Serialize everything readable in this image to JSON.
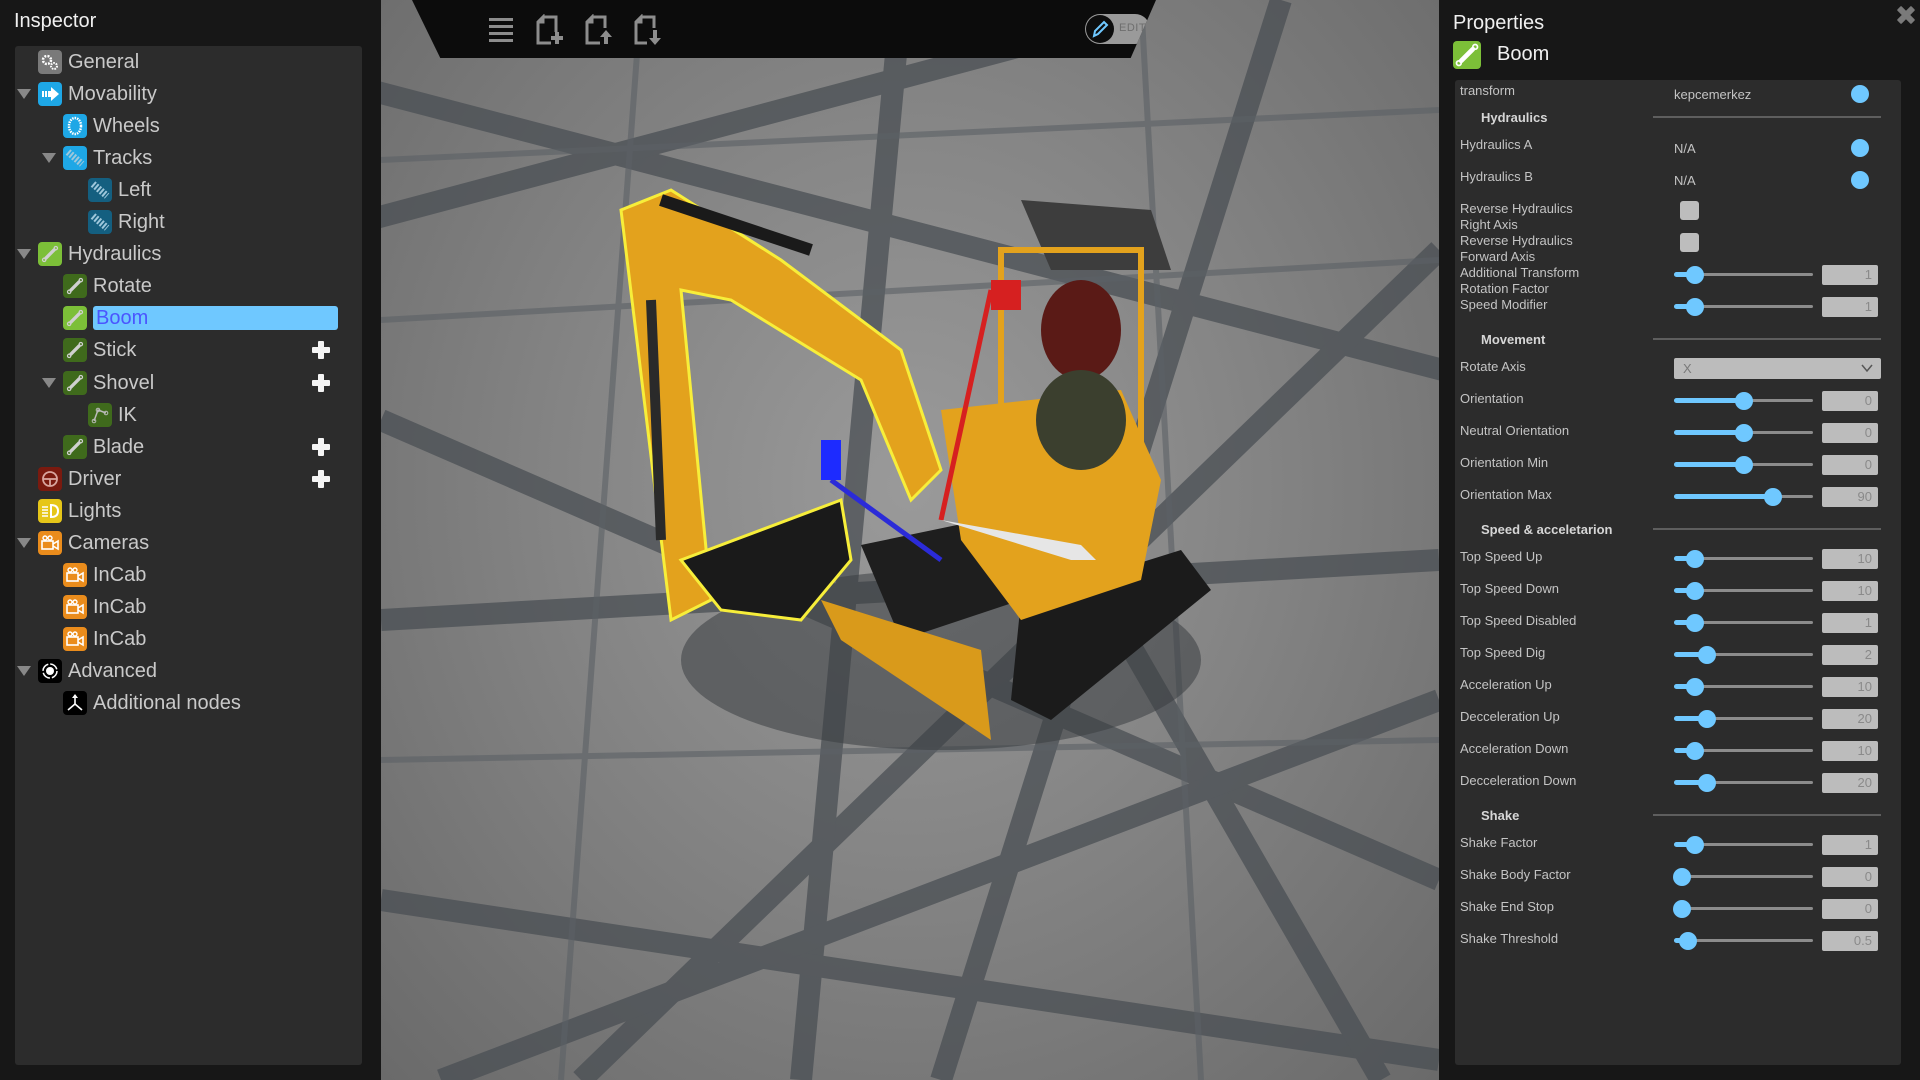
{
  "inspector": {
    "title": "Inspector",
    "tree": [
      {
        "label": "General",
        "level": 0,
        "expanded": null,
        "icon": "gears-icon",
        "icon_color": "#7a7a7a",
        "add": false,
        "selected": false
      },
      {
        "label": "Movability",
        "level": 0,
        "expanded": true,
        "icon": "arrow-right-icon",
        "icon_color": "#1ea7e6",
        "add": false,
        "selected": false
      },
      {
        "label": "Wheels",
        "level": 1,
        "expanded": null,
        "icon": "wheel-icon",
        "icon_color": "#1ea7e6",
        "add": false,
        "selected": false
      },
      {
        "label": "Tracks",
        "level": 1,
        "expanded": true,
        "icon": "track-icon",
        "icon_color": "#1ea7e6",
        "add": false,
        "selected": false
      },
      {
        "label": "Left",
        "level": 2,
        "expanded": null,
        "icon": "track-icon",
        "icon_color": "#145f80",
        "add": false,
        "selected": false
      },
      {
        "label": "Right",
        "level": 2,
        "expanded": null,
        "icon": "track-icon",
        "icon_color": "#145f80",
        "add": false,
        "selected": false
      },
      {
        "label": "Hydraulics",
        "level": 0,
        "expanded": true,
        "icon": "hydraulic-cylinder-icon",
        "icon_color": "#7cbf38",
        "add": false,
        "selected": false
      },
      {
        "label": "Rotate",
        "level": 1,
        "expanded": null,
        "icon": "hydraulic-cylinder-icon",
        "icon_color": "#3f6a1c",
        "add": false,
        "selected": false
      },
      {
        "label": "Boom",
        "level": 1,
        "expanded": null,
        "icon": "hydraulic-cylinder-icon",
        "icon_color": "#7cbf38",
        "add": false,
        "selected": true
      },
      {
        "label": "Stick",
        "level": 1,
        "expanded": null,
        "icon": "hydraulic-cylinder-icon",
        "icon_color": "#3f6a1c",
        "add": true,
        "selected": false
      },
      {
        "label": "Shovel",
        "level": 1,
        "expanded": true,
        "icon": "hydraulic-cylinder-icon",
        "icon_color": "#3f6a1c",
        "add": true,
        "selected": false
      },
      {
        "label": "IK",
        "level": 2,
        "expanded": null,
        "icon": "ik-chain-icon",
        "icon_color": "#3f6a1c",
        "add": false,
        "selected": false
      },
      {
        "label": "Blade",
        "level": 1,
        "expanded": null,
        "icon": "hydraulic-cylinder-icon",
        "icon_color": "#3f6a1c",
        "add": true,
        "selected": false
      },
      {
        "label": "Driver",
        "level": 0,
        "expanded": null,
        "icon": "steering-wheel-icon",
        "icon_color": "#7a1a0f",
        "add": true,
        "selected": false
      },
      {
        "label": "Lights",
        "level": 0,
        "expanded": null,
        "icon": "headlight-icon",
        "icon_color": "#e6c619",
        "add": false,
        "selected": false
      },
      {
        "label": "Cameras",
        "level": 0,
        "expanded": true,
        "icon": "camera-icon",
        "icon_color": "#ea8c1c",
        "add": false,
        "selected": false
      },
      {
        "label": "InCab",
        "level": 1,
        "expanded": null,
        "icon": "camera-icon",
        "icon_color": "#ea8c1c",
        "add": false,
        "selected": false
      },
      {
        "label": "InCab",
        "level": 1,
        "expanded": null,
        "icon": "camera-icon",
        "icon_color": "#ea8c1c",
        "add": false,
        "selected": false
      },
      {
        "label": "InCab",
        "level": 1,
        "expanded": null,
        "icon": "camera-icon",
        "icon_color": "#ea8c1c",
        "add": false,
        "selected": false
      },
      {
        "label": "Advanced",
        "level": 0,
        "expanded": true,
        "icon": "orbit-icon",
        "icon_color": "#000000",
        "add": false,
        "selected": false
      },
      {
        "label": "Additional nodes",
        "level": 1,
        "expanded": null,
        "icon": "axes-icon",
        "icon_color": "#000000",
        "add": false,
        "selected": false
      }
    ]
  },
  "toolbar": {
    "buttons": [
      {
        "name": "menu-button",
        "icon": "hamburger-icon"
      },
      {
        "name": "new-file-button",
        "icon": "file-add-icon"
      },
      {
        "name": "upload-file-button",
        "icon": "file-upload-icon"
      },
      {
        "name": "download-file-button",
        "icon": "file-download-icon"
      }
    ],
    "edit_toggle": {
      "label": "EDIT",
      "on": false
    }
  },
  "properties": {
    "title": "Properties",
    "node_name": "Boom",
    "node_icon": "hydraulic-cylinder-icon",
    "accent": "#6fc8ff",
    "transform": {
      "label": "transform",
      "value": "kepcemerkez"
    },
    "sections": [
      {
        "title": "Hydraulics",
        "rows": [
          {
            "type": "ref",
            "label": "Hydraulics A",
            "value": "N/A"
          },
          {
            "type": "ref",
            "label": "Hydraulics B",
            "value": "N/A"
          },
          {
            "type": "check",
            "label": "Reverse Hydraulics Right Axis",
            "checked": false
          },
          {
            "type": "check",
            "label": "Reverse Hydraulics Forward Axis",
            "checked": false
          },
          {
            "type": "slider",
            "label": "Additional Transform Rotation Factor",
            "value": "1",
            "fraction": 0.15
          },
          {
            "type": "slider",
            "label": "Speed Modifier",
            "value": "1",
            "fraction": 0.15
          }
        ]
      },
      {
        "title": "Movement",
        "rows": [
          {
            "type": "select",
            "label": "Rotate Axis",
            "value": "X"
          },
          {
            "type": "slider",
            "label": "Orientation",
            "value": "0",
            "fraction": 0.5
          },
          {
            "type": "slider",
            "label": "Neutral Orientation",
            "value": "0",
            "fraction": 0.5
          },
          {
            "type": "slider",
            "label": "Orientation Min",
            "value": "0",
            "fraction": 0.5
          },
          {
            "type": "slider",
            "label": "Orientation Max",
            "value": "90",
            "fraction": 0.71
          }
        ]
      },
      {
        "title": "Speed & acceletarion",
        "rows": [
          {
            "type": "slider",
            "label": "Top Speed Up",
            "value": "10",
            "fraction": 0.15
          },
          {
            "type": "slider",
            "label": "Top Speed Down",
            "value": "10",
            "fraction": 0.15
          },
          {
            "type": "slider",
            "label": "Top Speed Disabled",
            "value": "1",
            "fraction": 0.15
          },
          {
            "type": "slider",
            "label": "Top Speed Dig",
            "value": "2",
            "fraction": 0.24
          },
          {
            "type": "slider",
            "label": "Acceleration Up",
            "value": "10",
            "fraction": 0.15
          },
          {
            "type": "slider",
            "label": "Decceleration Up",
            "value": "20",
            "fraction": 0.24
          },
          {
            "type": "slider",
            "label": "Acceleration Down",
            "value": "10",
            "fraction": 0.15
          },
          {
            "type": "slider",
            "label": "Decceleration Down",
            "value": "20",
            "fraction": 0.24
          }
        ]
      },
      {
        "title": "Shake",
        "rows": [
          {
            "type": "slider",
            "label": "Shake Factor",
            "value": "1",
            "fraction": 0.15
          },
          {
            "type": "slider",
            "label": "Shake Body Factor",
            "value": "0",
            "fraction": 0.06
          },
          {
            "type": "slider",
            "label": "Shake End Stop",
            "value": "0",
            "fraction": 0.06
          },
          {
            "type": "slider",
            "label": "Shake Threshold",
            "value": "0.5",
            "fraction": 0.1
          }
        ]
      }
    ]
  }
}
